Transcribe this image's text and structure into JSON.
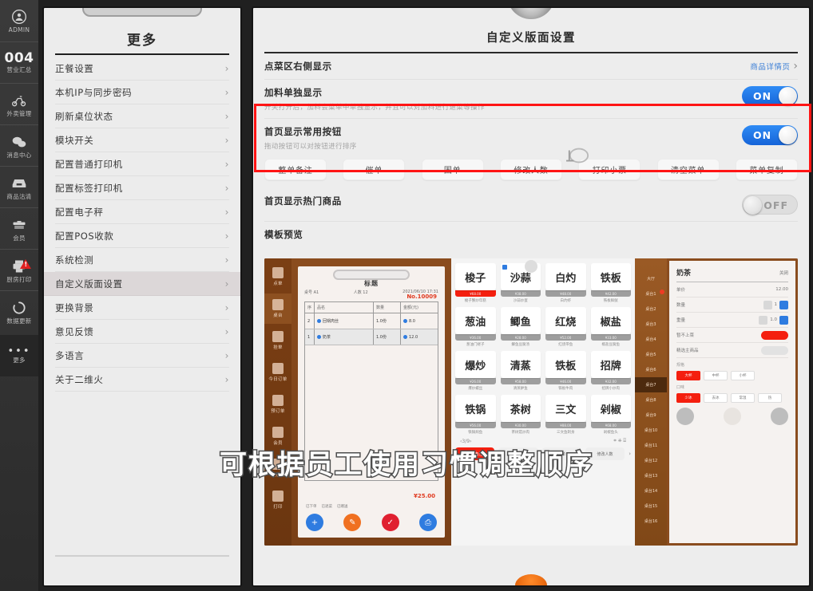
{
  "rail": {
    "items": [
      {
        "label": "ADMIN",
        "icon": "user-avatar-icon",
        "type": "avatar"
      },
      {
        "label": "营业汇总",
        "icon": "report-icon",
        "value": "004",
        "type": "number"
      },
      {
        "label": "外卖管理",
        "icon": "scooter-icon",
        "type": "icon"
      },
      {
        "label": "消息中心",
        "icon": "chat-bubble-icon",
        "type": "icon"
      },
      {
        "label": "商品沽清",
        "icon": "inbox-icon",
        "type": "icon"
      },
      {
        "label": "会员",
        "icon": "member-card-icon",
        "type": "icon"
      },
      {
        "label": "厨房打印",
        "icon": "printer-icon",
        "type": "icon",
        "alert": true
      },
      {
        "label": "数据更新",
        "icon": "refresh-icon",
        "type": "icon"
      },
      {
        "label": "更多",
        "icon": "ellipsis-icon",
        "type": "dots"
      }
    ]
  },
  "menu": {
    "title": "更多",
    "items": [
      {
        "label": "正餐设置",
        "active": false
      },
      {
        "label": "本机IP与同步密码",
        "active": false
      },
      {
        "label": "刷新桌位状态",
        "active": false
      },
      {
        "label": "模块开关",
        "active": false
      },
      {
        "label": "配置普通打印机",
        "active": false
      },
      {
        "label": "配置标签打印机",
        "active": false
      },
      {
        "label": "配置电子秤",
        "active": false
      },
      {
        "label": "配置POS收款",
        "active": false
      },
      {
        "label": "系统检测",
        "active": false
      },
      {
        "label": "自定义版面设置",
        "active": true
      },
      {
        "label": "更换背景",
        "active": false
      },
      {
        "label": "意见反馈",
        "active": false
      },
      {
        "label": "多语言",
        "active": false
      },
      {
        "label": "关于二维火",
        "active": false
      }
    ],
    "chevron": "›"
  },
  "settings": {
    "title": "自定义版面设置",
    "rows": [
      {
        "label": "点菜区右侧显示",
        "desc": "",
        "control": "link",
        "link_text": "商品详情页",
        "chevron": "›"
      },
      {
        "label": "加料单独显示",
        "desc": "开关打开后，加料会菜单中单独显示，并且可以对加料进行退菜等操作",
        "control": "toggle",
        "toggle_state": "ON"
      },
      {
        "label": "首页显示常用按钮",
        "desc": "拖动按钮可以对按钮进行排序",
        "control": "toggle",
        "toggle_state": "ON",
        "highlighted": true
      },
      {
        "label": "首页显示热门商品",
        "desc": "",
        "control": "toggle",
        "toggle_state": "OFF"
      },
      {
        "label": "模板预览",
        "desc": "",
        "control": "none"
      }
    ],
    "quick_buttons": [
      {
        "label": "整单备注"
      },
      {
        "label": "催单"
      },
      {
        "label": "围单"
      },
      {
        "label": "修改人数"
      },
      {
        "label": "打印小票",
        "dragging": true
      },
      {
        "label": "清空菜单"
      },
      {
        "label": "菜单复制"
      }
    ],
    "toggle_on_color": "#1f7bf0",
    "toggle_off_color": "#dedede",
    "highlight_color": "#ff1414",
    "link_color": "#3c7fd6"
  },
  "caption": "可根据员工使用习惯调整顺序",
  "preview": {
    "rail": [
      {
        "label": "点单"
      },
      {
        "label": "桌台",
        "selected": true
      },
      {
        "label": "挂单"
      },
      {
        "label": "今日订单"
      },
      {
        "label": "预订单"
      },
      {
        "label": "会员"
      },
      {
        "label": "交接班"
      },
      {
        "label": "打印"
      }
    ],
    "order_sheet": {
      "title": "标题",
      "order_no": "No.10009",
      "date": "2021/06/10 17:31",
      "meta_left": "桌号 A1",
      "meta_right": "人数 12",
      "columns": [
        "序",
        "品名",
        "数量",
        "金额(元)"
      ],
      "rows": [
        {
          "index": "2",
          "name": "回锅肉丝",
          "qty": "1.0份",
          "amount": "8.0"
        },
        {
          "index": "1",
          "name": "奶茶",
          "qty": "1.0份",
          "amount": "12.0"
        }
      ],
      "total": "¥25.00",
      "legend": [
        "已下单",
        "已退菜",
        "已赠送"
      ],
      "actions": [
        "加菜",
        "修改",
        "确认",
        "打印"
      ]
    },
    "dishes": {
      "tiles": [
        {
          "title": "梭子",
          "caption": "梭子蟹炒年糕",
          "bar": "¥68.00",
          "bar_red": true
        },
        {
          "title": "沙蒜",
          "caption": "沙蒜炒蛋",
          "bar": "¥38.00",
          "marked": true
        },
        {
          "title": "白灼",
          "caption": "白灼虾",
          "bar": "¥48.00"
        },
        {
          "title": "铁板",
          "caption": "铁板鲜鱿",
          "bar": "¥42.00"
        },
        {
          "title": "葱油",
          "caption": "葱油门蛏子",
          "bar": "¥36.00"
        },
        {
          "title": "鲫鱼",
          "caption": "鲫鱼豆腐汤",
          "bar": "¥28.00"
        },
        {
          "title": "红烧",
          "caption": "红烧带鱼",
          "bar": "¥52.00"
        },
        {
          "title": "椒盐",
          "caption": "椒盐豆腐鱼",
          "bar": "¥33.00"
        },
        {
          "title": "爆炒",
          "caption": "爆炒螺丝",
          "bar": "¥26.00"
        },
        {
          "title": "清蒸",
          "caption": "清蒸鲈鱼",
          "bar": "¥58.00"
        },
        {
          "title": "铁板",
          "caption": "铁板牛肉",
          "bar": "¥46.00"
        },
        {
          "title": "招牌",
          "caption": "招牌小炒肉",
          "bar": "¥32.00"
        },
        {
          "title": "铁锅",
          "caption": "铁锅焖鱼",
          "bar": "¥56.00"
        },
        {
          "title": "茶树",
          "caption": "茶树菇炒肉",
          "bar": "¥30.00"
        },
        {
          "title": "三文",
          "caption": "三文鱼刺身",
          "bar": "¥88.00"
        },
        {
          "title": "剁椒",
          "caption": "剁椒鱼头",
          "bar": "¥68.00"
        }
      ],
      "pager": "3/9",
      "bottom_buttons": [
        {
          "label": "整单备注",
          "red": true
        },
        {
          "label": "催单"
        },
        {
          "label": "围单"
        },
        {
          "label": "修改人数"
        }
      ]
    },
    "tables": {
      "items": [
        "大厅",
        "桌台1",
        "桌台2",
        "桌台3",
        "桌台4",
        "桌台5",
        "桌台6",
        "桌台7",
        "桌台8",
        "桌台9",
        "桌台10",
        "桌台11",
        "桌台12",
        "桌台13",
        "桌台14",
        "桌台15",
        "桌台16"
      ],
      "selected": "桌台7",
      "alert_on": "桌台1"
    },
    "detail": {
      "title": "奶茶",
      "close_label": "关闭",
      "rows": [
        {
          "label": "单价",
          "value": "12.00"
        },
        {
          "label": "数量",
          "value": "1"
        },
        {
          "label": "重量",
          "value": "1.0"
        },
        {
          "label": "暂不上菜",
          "value": "ON"
        },
        {
          "label": "精选主商品",
          "value": "OFF"
        }
      ],
      "section_label": "规格",
      "chips": [
        "大杯",
        "中杯",
        "小杯"
      ],
      "section2_label": "口味",
      "chips2": [
        "少冰",
        "去冰",
        "常温",
        "热"
      ],
      "footer_buttons": [
        "减少",
        "备注",
        "增加"
      ]
    }
  }
}
